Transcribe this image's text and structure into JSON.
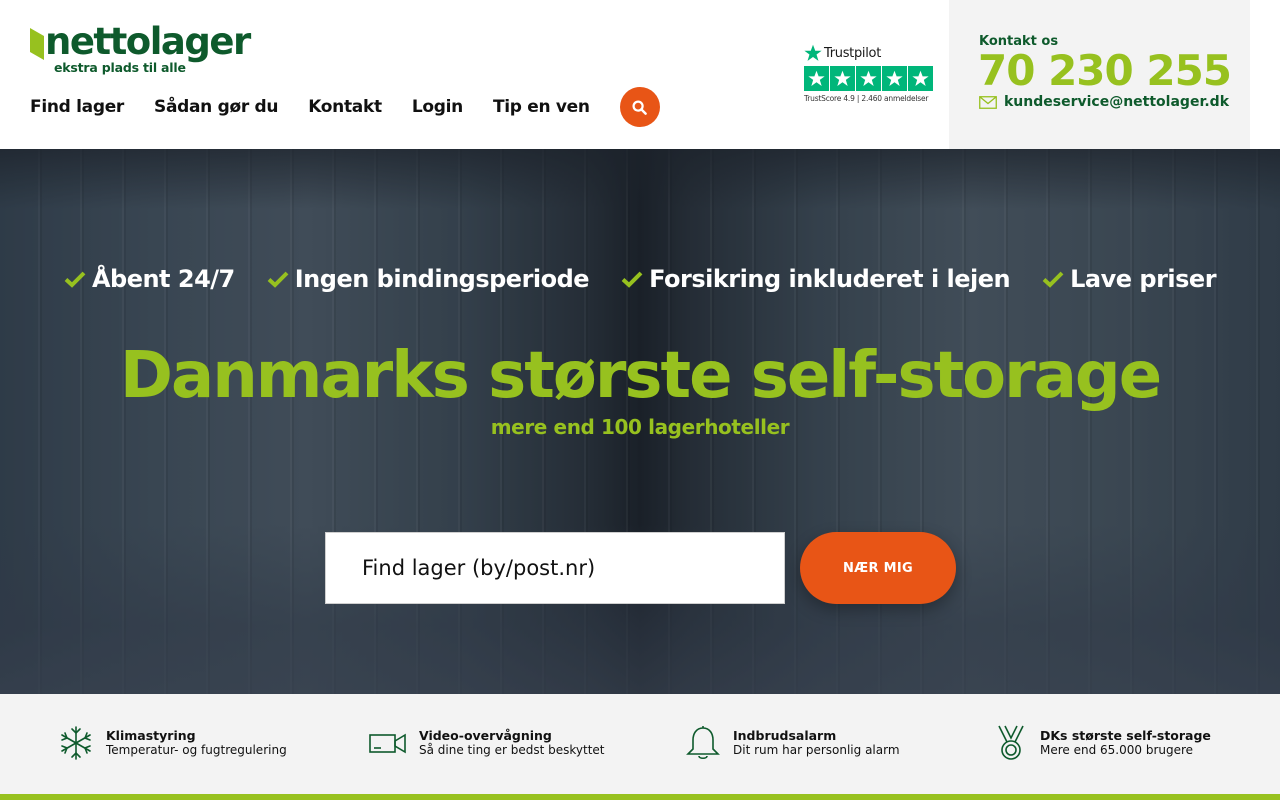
{
  "brand": {
    "name": "nettolager",
    "tagline": "ekstra plads til alle",
    "colors": {
      "primary_green": "#0e5a2c",
      "lime": "#97c11f",
      "orange": "#e85516"
    }
  },
  "nav": {
    "items": [
      {
        "label": "Find lager"
      },
      {
        "label": "Sådan gør du"
      },
      {
        "label": "Kontakt"
      },
      {
        "label": "Login"
      },
      {
        "label": "Tip en ven"
      }
    ],
    "search_icon": "search-icon"
  },
  "trustpilot": {
    "name": "Trustpilot",
    "stars": 5,
    "score_text": "TrustScore 4.9 | 2.460 anmeldelser"
  },
  "contact": {
    "label": "Kontakt os",
    "phone": "70 230 255",
    "email": "kundeservice@nettolager.dk",
    "email_icon": "envelope-icon"
  },
  "hero": {
    "usps": [
      {
        "label": "Åbent 24/7"
      },
      {
        "label": "Ingen bindingsperiode"
      },
      {
        "label": "Forsikring inkluderet i lejen"
      },
      {
        "label": "Lave priser"
      }
    ],
    "title": "Danmarks største self-storage",
    "subtitle": "mere end 100 lagerhoteller",
    "search": {
      "placeholder": "Find lager (by/post.nr)",
      "value": ""
    },
    "near_button": "NÆR MIG"
  },
  "features": [
    {
      "icon": "snowflake-icon",
      "title": "Klimastyring",
      "desc": "Temperatur- og fugtregulering"
    },
    {
      "icon": "video-camera-icon",
      "title": "Video-overvågning",
      "desc": "Så dine ting er bedst beskyttet"
    },
    {
      "icon": "bell-icon",
      "title": "Indbrudsalarm",
      "desc": "Dit rum har personlig alarm"
    },
    {
      "icon": "medal-icon",
      "title": "DKs største self-storage",
      "desc": "Mere end 65.000 brugere"
    }
  ]
}
